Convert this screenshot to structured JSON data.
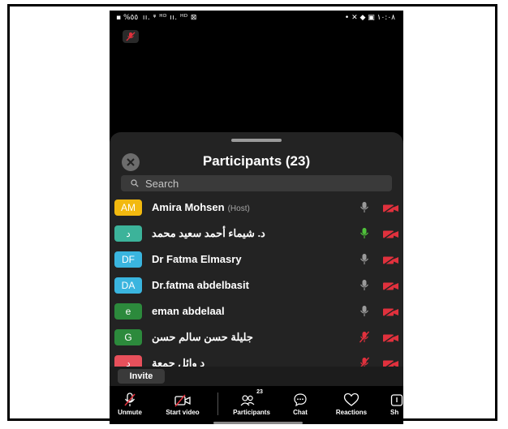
{
  "status_bar": {
    "left": "▪ %٥٥ ‌‌ ıı. ᵠ ᴴᴰ ıı. ᴴᴰ ⊠",
    "right": "• ✕ ◆ ▣ ١٠:٠٨"
  },
  "panel": {
    "title": "Participants (23)",
    "search_placeholder": "Search",
    "host_tag": "(Host)"
  },
  "participants": [
    {
      "initials": "AM",
      "name": "Amira Mohsen",
      "is_host": true,
      "avatar_color": "#f2b90f",
      "mic": "muted-grey",
      "video": "off"
    },
    {
      "initials": "د",
      "name": "د. شيماء أحمد سعيد محمد",
      "is_host": false,
      "avatar_color": "#3cb39a",
      "mic": "active-green",
      "video": "off"
    },
    {
      "initials": "DF",
      "name": "Dr Fatma Elmasry",
      "is_host": false,
      "avatar_color": "#3ab5df",
      "mic": "muted-grey",
      "video": "off"
    },
    {
      "initials": "DA",
      "name": "Dr.fatma abdelbasit",
      "is_host": false,
      "avatar_color": "#3ab5df",
      "mic": "muted-grey",
      "video": "off"
    },
    {
      "initials": "e",
      "name": "eman abdelaal",
      "is_host": false,
      "avatar_color": "#2c8a3c",
      "mic": "muted-grey",
      "video": "off"
    },
    {
      "initials": "G",
      "name": "جليلة حسن سالم حسن",
      "is_host": false,
      "avatar_color": "#2c8a3c",
      "mic": "muted-red",
      "video": "off"
    },
    {
      "initials": "د",
      "name": "د وائل جمعة",
      "is_host": false,
      "avatar_color": "#e8505b",
      "mic": "muted-red",
      "video": "off"
    }
  ],
  "invite_label": "Invite",
  "toolbar": {
    "unmute": "Unmute",
    "start_video": "Start video",
    "participants": "Participants",
    "participants_count": "23",
    "chat": "Chat",
    "reactions": "Reactions",
    "share": "Sh"
  },
  "colors": {
    "muted_red": "#e0313d",
    "mic_green": "#4fc23a",
    "sheet_bg": "#232323"
  }
}
